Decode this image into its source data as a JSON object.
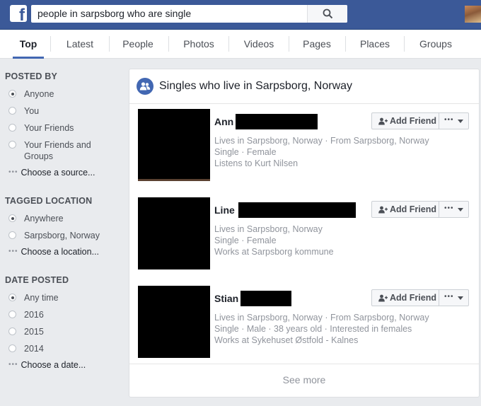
{
  "topbar": {
    "logo_letter": "f",
    "search_query": "people in sarpsborg who are single",
    "search_icon": "search-icon"
  },
  "tabs": [
    "Top",
    "Latest",
    "People",
    "Photos",
    "Videos",
    "Pages",
    "Places",
    "Groups"
  ],
  "active_tab": "Top",
  "filters": {
    "posted_by": {
      "title": "POSTED BY",
      "options": [
        "Anyone",
        "You",
        "Your Friends",
        "Your Friends and Groups"
      ],
      "selected": "Anyone",
      "choose": "Choose a source..."
    },
    "tagged_location": {
      "title": "TAGGED LOCATION",
      "options": [
        "Anywhere",
        "Sarpsborg, Norway"
      ],
      "selected": "Anywhere",
      "choose": "Choose a location..."
    },
    "date_posted": {
      "title": "DATE POSTED",
      "options": [
        "Any time",
        "2016",
        "2015",
        "2014"
      ],
      "selected": "Any time",
      "choose": "Choose a date..."
    }
  },
  "results": {
    "header": "Singles who live in Sarpsborg, Norway",
    "people": [
      {
        "first_name": "Ann",
        "lines": [
          "Lives in Sarpsborg, Norway · From Sarpsborg, Norway",
          "Single · Female",
          "Listens to Kurt Nilsen"
        ]
      },
      {
        "first_name": "Line",
        "lines": [
          "Lives in Sarpsborg, Norway",
          "Single · Female",
          "Works at Sarpsborg kommune"
        ]
      },
      {
        "first_name": "Stian",
        "lines": [
          "Lives in Sarpsborg, Norway · From Sarpsborg, Norway",
          "Single · Male · 38 years old · Interested in females",
          "Works at Sykehuset Østfold - Kalnes"
        ]
      }
    ],
    "add_friend_label": "Add Friend",
    "see_more": "See more"
  },
  "colors": {
    "brand_blue": "#3b5998",
    "accent": "#4267b2",
    "background": "#e9ebee"
  }
}
